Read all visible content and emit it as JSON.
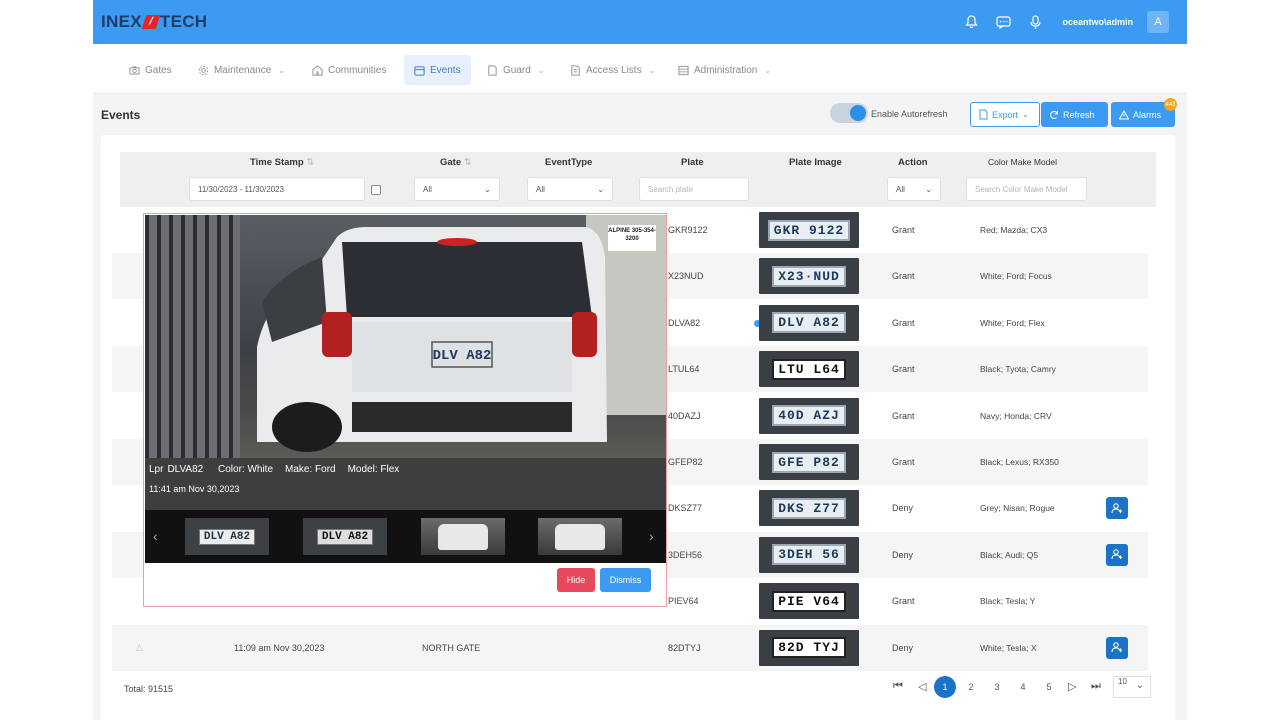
{
  "brand": {
    "logo_a": "INEX",
    "logo_b": "TECH"
  },
  "user": {
    "name": "oceantwo\\admin",
    "initial": "A"
  },
  "nav": [
    {
      "label": "Gates",
      "icon": "camera-icon",
      "chevron": false
    },
    {
      "label": "Maintenance",
      "icon": "gear-icon",
      "chevron": true
    },
    {
      "label": "Communities",
      "icon": "building-icon",
      "chevron": false
    },
    {
      "label": "Events",
      "icon": "calendar-icon",
      "chevron": false,
      "active": true
    },
    {
      "label": "Guard",
      "icon": "document-icon",
      "chevron": true
    },
    {
      "label": "Access Lists",
      "icon": "list-icon",
      "chevron": true
    },
    {
      "label": "Administration",
      "icon": "table-icon",
      "chevron": true
    }
  ],
  "page": {
    "title": "Events",
    "autorefresh_label": "Enable Autorefresh",
    "autorefresh_on": true,
    "export_label": "Export",
    "refresh_label": "Refresh",
    "alarms_label": "Alarms",
    "alarms_count": "443"
  },
  "columns": {
    "timestamp": "Time Stamp",
    "gate": "Gate",
    "event_type": "EventType",
    "plate": "Plate",
    "plate_image": "Plate Image",
    "action": "Action",
    "cmm": "Color Make Model"
  },
  "filters": {
    "date_range": "11/30/2023 - 11/30/2023",
    "gate": "All",
    "event_type": "All",
    "plate_placeholder": "Search plate",
    "action": "All",
    "cmm_placeholder": "Search Color Make Model"
  },
  "rows": [
    {
      "plate": "GKR9122",
      "img_text": "GKR 9122",
      "action": "Grant",
      "cmm": "Red; Mazda; CX3",
      "user_btn": false
    },
    {
      "plate": "X23NUD",
      "img_text": "X23·NUD",
      "action": "Grant",
      "cmm": "White; Ford; Focus",
      "user_btn": false
    },
    {
      "plate": "DLVA82",
      "img_text": "DLV A82",
      "action": "Grant",
      "cmm": "White; Ford; Flex",
      "user_btn": false,
      "selected": true
    },
    {
      "plate": "LTUL64",
      "img_text": "LTU L64",
      "action": "Grant",
      "cmm": "Black; Tyota; Camry",
      "user_btn": false,
      "dark": true
    },
    {
      "plate": "40DAZJ",
      "img_text": "40D AZJ",
      "action": "Grant",
      "cmm": "Navy; Honda; CRV",
      "user_btn": false
    },
    {
      "plate": "GFEP82",
      "img_text": "GFE P82",
      "action": "Grant",
      "cmm": "Black; Lexus; RX350",
      "user_btn": false
    },
    {
      "plate": "DKSZ77",
      "img_text": "DKS Z77",
      "action": "Deny",
      "cmm": "Grey; Nisan; Rogue",
      "user_btn": true
    },
    {
      "plate": "3DEH56",
      "img_text": "3DEH 56",
      "action": "Deny",
      "cmm": "Black; Audi; Q5",
      "user_btn": true
    },
    {
      "plate": "PIEV64",
      "img_text": "PIE V64",
      "action": "Grant",
      "cmm": "Black; Tesla; Y",
      "user_btn": false,
      "dark": true
    },
    {
      "plate": "82DTYJ",
      "img_text": "82D TYJ",
      "action": "Deny",
      "cmm": "White; Tesla; X",
      "user_btn": true,
      "dark": true,
      "timestamp": "11:09 am Nov 30,2023",
      "gate": "NORTH GATE"
    }
  ],
  "popup": {
    "lpr_label": "Lpr",
    "lpr_value": "DLVA82",
    "color": "Color: White",
    "make": "Make: Ford",
    "model": "Model: Flex",
    "time": "11:41 am Nov 30,2023",
    "sign_text": "ALPINE 305-354-3200",
    "car_plate": "DLV A82",
    "thumb_plates": [
      "DLV A82",
      "DLV A82"
    ],
    "hide_label": "Hide",
    "dismiss_label": "Dismiss"
  },
  "footer": {
    "total": "Total: 91515",
    "pages": [
      "1",
      "2",
      "3",
      "4",
      "5"
    ],
    "current_page": "1",
    "page_size": "10"
  }
}
